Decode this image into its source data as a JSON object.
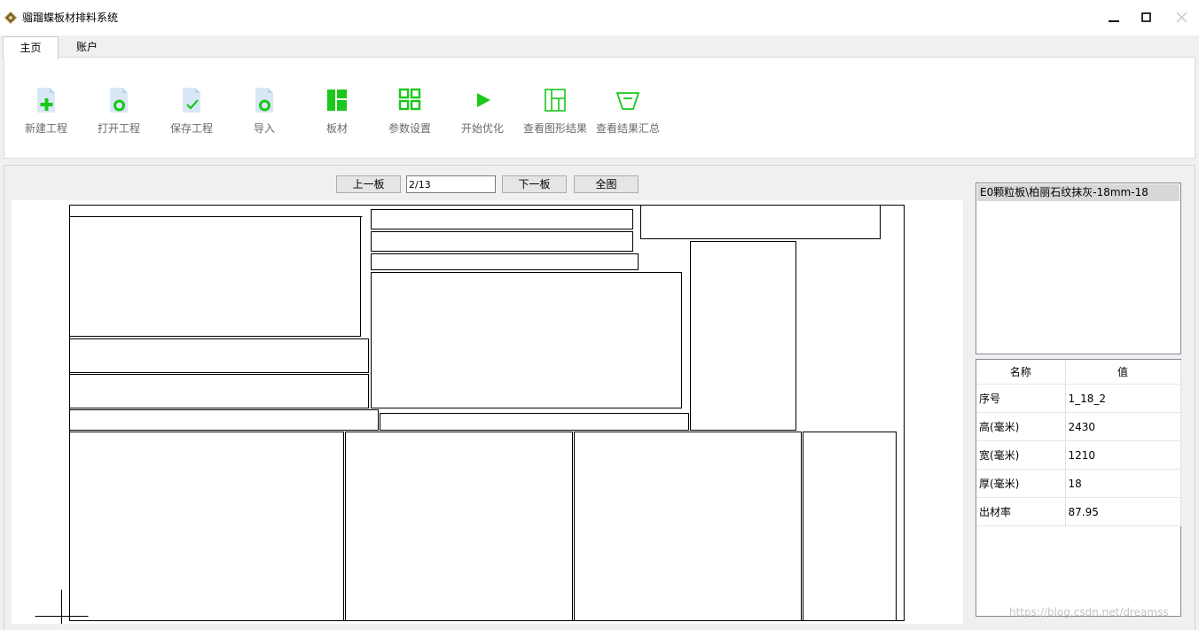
{
  "window": {
    "title": "骝蹓蝶板材排料系统",
    "controls": [
      "minimize-icon",
      "maximize-icon",
      "close-icon"
    ]
  },
  "tabs": [
    {
      "label": "主页",
      "active": true
    },
    {
      "label": "账户",
      "active": false
    }
  ],
  "ribbon": {
    "accent_color": "#1ac71a",
    "light_color": "#d9e8f6",
    "buttons": [
      {
        "label": "新建工程",
        "icon": "new-file-icon"
      },
      {
        "label": "打开工程",
        "icon": "open-file-icon"
      },
      {
        "label": "保存工程",
        "icon": "save-file-icon"
      },
      {
        "label": "导入",
        "icon": "import-file-icon"
      },
      {
        "label": "板材",
        "icon": "board-layout-icon"
      },
      {
        "label": "参数设置",
        "icon": "grid-settings-icon"
      },
      {
        "label": "开始优化",
        "icon": "play-icon"
      },
      {
        "label": "查看图形结果",
        "icon": "layout-result-icon"
      },
      {
        "label": "查看结果汇总",
        "icon": "summary-tray-icon"
      }
    ]
  },
  "navigation": {
    "prev_label": "上一板",
    "page_value": "2/13",
    "next_label": "下一板",
    "fit_label": "全图"
  },
  "board_list": {
    "items": [
      "E0颗粒板\\柏丽石纹抹灰-18mm-18"
    ],
    "selected_index": 0
  },
  "properties": {
    "headers": {
      "name": "名称",
      "value": "值"
    },
    "rows": [
      {
        "name": "序号",
        "value": "1_18_2"
      },
      {
        "name": "高(毫米)",
        "value": "2430"
      },
      {
        "name": "宽(毫米)",
        "value": "1210"
      },
      {
        "name": "厚(毫米)",
        "value": "18"
      },
      {
        "name": "出材率",
        "value": "87.95"
      }
    ]
  },
  "watermark": "https://blog.csdn.net/dreamss"
}
